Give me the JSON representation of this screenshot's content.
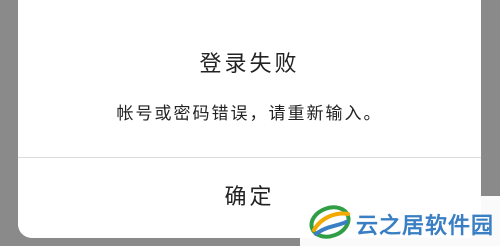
{
  "dialog": {
    "title": "登录失败",
    "message": "帐号或密码错误，请重新输入。",
    "confirm_label": "确定"
  },
  "watermark": {
    "text": "云之居软件园",
    "logo_icon": "swirl-logo-icon",
    "text_color": "#3a7fc4"
  },
  "colors": {
    "backdrop": "#8a8a8a",
    "dialog_bg": "#ffffff",
    "text": "#222222",
    "divider": "#dcdcdc"
  }
}
